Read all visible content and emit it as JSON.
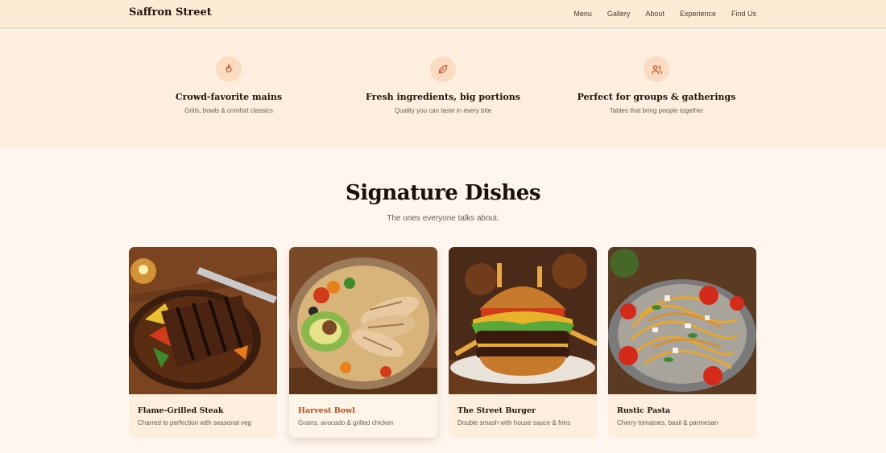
{
  "brand": "Saffron Street",
  "nav": [
    "Menu",
    "Gallery",
    "About",
    "Experience",
    "Find Us"
  ],
  "features": [
    {
      "icon": "flame-icon",
      "title": "Crowd-favorite mains",
      "subtitle": "Grills, bowls & comfort classics"
    },
    {
      "icon": "leaf-icon",
      "title": "Fresh ingredients, big portions",
      "subtitle": "Quality you can taste in every bite"
    },
    {
      "icon": "people-icon",
      "title": "Perfect for groups & gatherings",
      "subtitle": "Tables that bring people together"
    }
  ],
  "signature": {
    "title": "Signature Dishes",
    "subtitle": "The ones everyone talks about."
  },
  "dishes": [
    {
      "title": "Flame-Grilled Steak",
      "description": "Charred to perfection with seasonal veg"
    },
    {
      "title": "Harvest Bowl",
      "description": "Grains, avocado & grilled chicken"
    },
    {
      "title": "The Street Burger",
      "description": "Double smash with house sauce & fries"
    },
    {
      "title": "Rustic Pasta",
      "description": "Cherry tomatoes, basil & parmesan"
    }
  ],
  "colors": {
    "accent": "#c44a1c",
    "nav_bg": "#fdebd6",
    "page_bg": "#fff6ef"
  }
}
